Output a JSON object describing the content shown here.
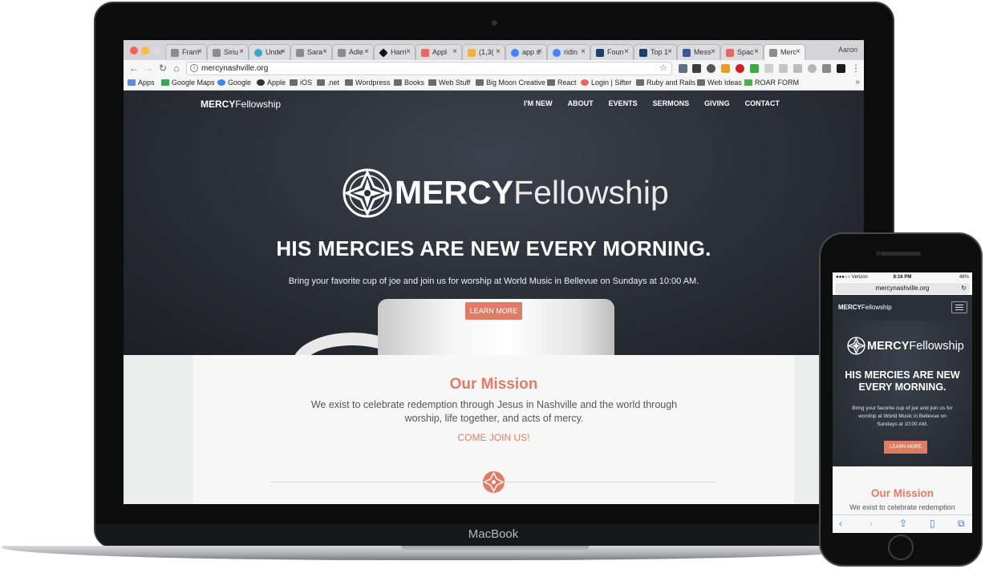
{
  "browser": {
    "tabs": [
      {
        "label": "Fram"
      },
      {
        "label": "Siriu"
      },
      {
        "label": "Unde"
      },
      {
        "label": "Sara"
      },
      {
        "label": "Adle"
      },
      {
        "label": "Harri"
      },
      {
        "label": "Appl"
      },
      {
        "label": "(1,3("
      },
      {
        "label": "app s"
      },
      {
        "label": "ridin"
      },
      {
        "label": "Foun"
      },
      {
        "label": "Top 1"
      },
      {
        "label": "Mess"
      },
      {
        "label": "Spac"
      },
      {
        "label": "Merc"
      }
    ],
    "tab_close": "×",
    "profile": "Aaron",
    "url": "mercynashville.org",
    "bookmarks": [
      "Apps",
      "Google Maps",
      "Google",
      "Apple",
      "iOS",
      ".net",
      "Wordpress",
      "Books",
      "Web Stuff",
      "Big Moon Creative",
      "React",
      "Login | Sifter",
      "Ruby and Rails",
      "Web Ideas",
      "ROAR FORM"
    ],
    "bookmarks_more": "»"
  },
  "site": {
    "logo_bold": "MERCY",
    "logo_light": "Fellowship",
    "nav": [
      "I'M NEW",
      "ABOUT",
      "EVENTS",
      "SERMONS",
      "GIVING",
      "CONTACT"
    ],
    "hero_headline": "HIS MERCIES ARE NEW EVERY MORNING.",
    "hero_sub": "Bring your favorite cup of joe and join us for worship at World Music in Bellevue on Sundays at 10:00 AM.",
    "cta": "LEARN MORE",
    "mission_title": "Our Mission",
    "mission_text": "We exist to celebrate redemption through Jesus in Nashville and the world through worship, life together, and acts of mercy.",
    "mission_cta": "COME JOIN US!"
  },
  "laptop": {
    "brand": "MacBook"
  },
  "phone": {
    "carrier": "●●●○○ Verizon",
    "time": "8:16 PM",
    "battery": "48%",
    "url": "mercynashville.org",
    "mission_text": "We exist to celebrate redemption",
    "hero_sub": "Bring your favorite cup of joe and join us for worship at World Music in Bellevue on Sundays at 10:00 AM."
  },
  "colors": {
    "accent": "#e07c65",
    "hero_bg": "#2a2e36",
    "mission_bg": "#f7f7f7"
  }
}
